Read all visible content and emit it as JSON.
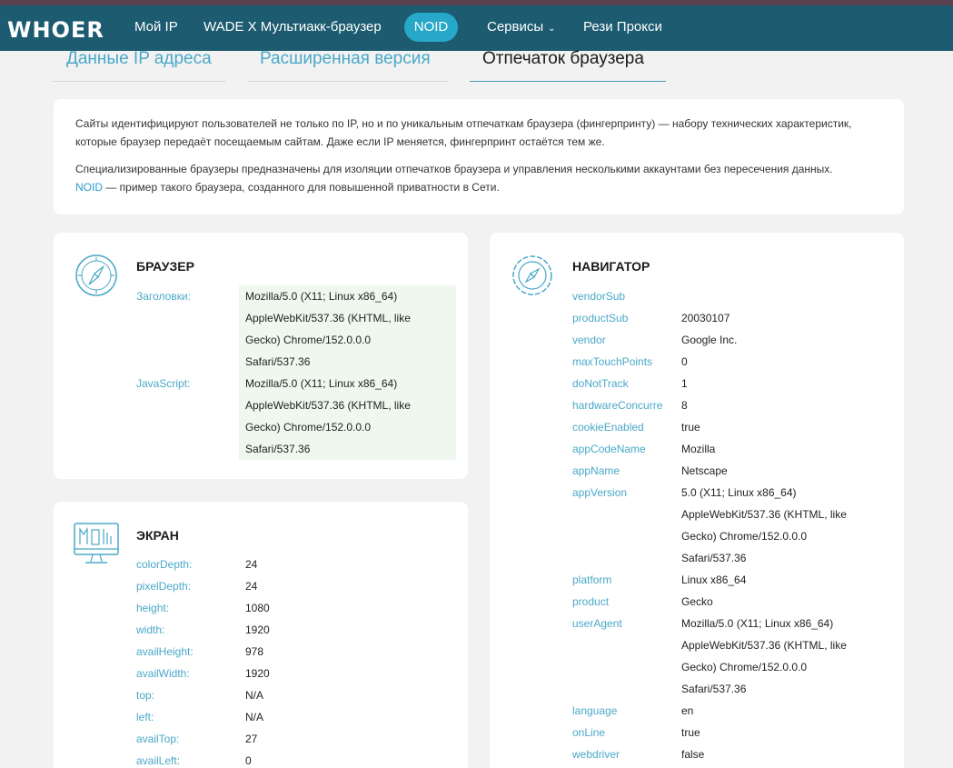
{
  "brand": {
    "logo": "WHOER"
  },
  "nav": {
    "my_ip": "Мой IP",
    "wade": "WADE X Мультиакк-браузер",
    "noid": "NOID",
    "services": "Сервисы",
    "proxy": "Рези Прокси"
  },
  "tabs": {
    "ip_data": "Данные IP адреса",
    "extended": "Расширенная версия",
    "fingerprint": "Отпечаток браузера"
  },
  "intro": {
    "p1": "Сайты идентифицируют пользователей не только по IP, но и по уникальным отпечаткам браузера (фингерпринту) — набору технических характеристик, которые браузер передаёт посещаемым сайтам. Даже если IP меняется, фингерпринт остаётся тем же.",
    "p2_text": "Специализированные браузеры предназначены для изоляции отпечатков браузера и управления несколькими аккаунтами без пересечения данных.",
    "p2_link": "NOID",
    "p2_tail": " — пример такого браузера, созданного для повышенной приватности в Сети."
  },
  "browser": {
    "title": "БРАУЗЕР",
    "headers_label": "Заголовки:",
    "headers_value": "Mozilla/5.0 (X11; Linux x86_64) AppleWebKit/537.36 (KHTML, like Gecko) Chrome/152.0.0.0 Safari/537.36",
    "js_label": "JavaScript:",
    "js_value": "Mozilla/5.0 (X11; Linux x86_64) AppleWebKit/537.36 (KHTML, like Gecko) Chrome/152.0.0.0 Safari/537.36"
  },
  "screen": {
    "title": "ЭКРАН",
    "rows": [
      {
        "k": "colorDepth:",
        "v": "24"
      },
      {
        "k": "pixelDepth:",
        "v": "24"
      },
      {
        "k": "height:",
        "v": "1080"
      },
      {
        "k": "width:",
        "v": "1920"
      },
      {
        "k": "availHeight:",
        "v": "978"
      },
      {
        "k": "availWidth:",
        "v": "1920"
      },
      {
        "k": "top:",
        "v": "N/A"
      },
      {
        "k": "left:",
        "v": "N/A"
      },
      {
        "k": "availTop:",
        "v": "27"
      },
      {
        "k": "availLeft:",
        "v": "0"
      }
    ]
  },
  "navigator": {
    "title": "НАВИГАТОР",
    "rows": [
      {
        "k": "vendorSub",
        "v": ""
      },
      {
        "k": "productSub",
        "v": "20030107"
      },
      {
        "k": "vendor",
        "v": "Google Inc."
      },
      {
        "k": "maxTouchPoints",
        "v": "0"
      },
      {
        "k": "doNotTrack",
        "v": "1"
      },
      {
        "k": "hardwareConcurrency",
        "v": "8"
      },
      {
        "k": "cookieEnabled",
        "v": "true"
      },
      {
        "k": "appCodeName",
        "v": "Mozilla"
      },
      {
        "k": "appName",
        "v": "Netscape"
      },
      {
        "k": "appVersion",
        "v": "5.0 (X11; Linux x86_64) AppleWebKit/537.36 (KHTML, like Gecko) Chrome/152.0.0.0 Safari/537.36"
      },
      {
        "k": "platform",
        "v": "Linux x86_64"
      },
      {
        "k": "product",
        "v": "Gecko"
      },
      {
        "k": "userAgent",
        "v": "Mozilla/5.0 (X11; Linux x86_64) AppleWebKit/537.36 (KHTML, like Gecko) Chrome/152.0.0.0 Safari/537.36"
      },
      {
        "k": "language",
        "v": "en"
      },
      {
        "k": "onLine",
        "v": "true"
      },
      {
        "k": "webdriver",
        "v": "false"
      }
    ]
  },
  "icons": {
    "browser": "compass-icon",
    "navigator": "compass-gear-icon",
    "screen": "monitor-icon",
    "services_chevron": "chevron-down-icon"
  },
  "colors": {
    "navbar": "#1c5b70",
    "accent": "#4aa8c8",
    "pill": "#28a8c9",
    "value_bg": "#eef8ee"
  }
}
